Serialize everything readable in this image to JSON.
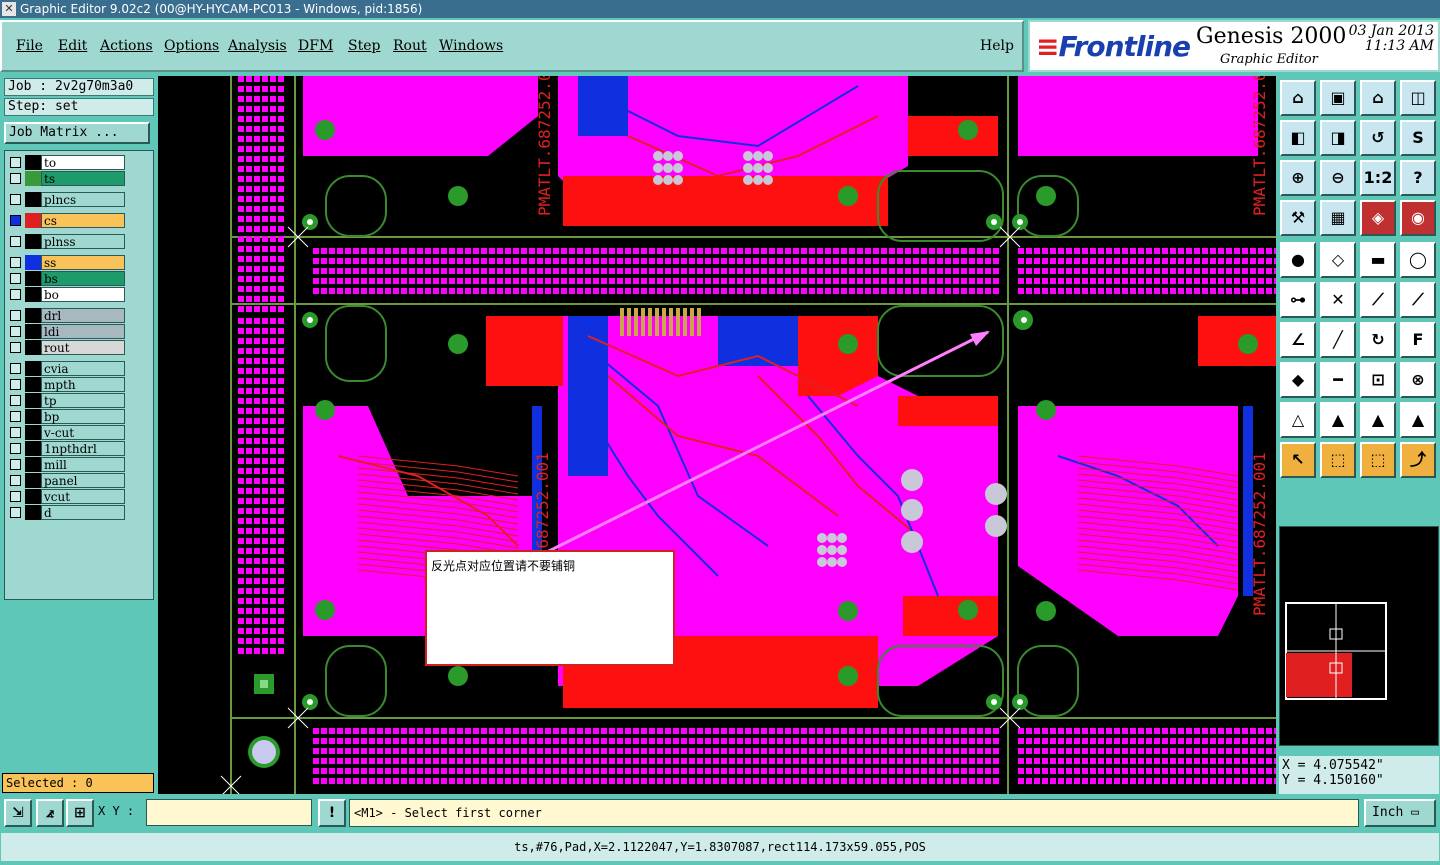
{
  "window": {
    "title": "Graphic Editor 9.02c2 (00@HY-HYCAM-PC013 - Windows, pid:1856)"
  },
  "menu": [
    "File",
    "Edit",
    "Actions",
    "Options",
    "Analysis",
    "DFM",
    "Step",
    "Rout",
    "Windows"
  ],
  "help": "Help",
  "brand": {
    "logo": "Frontline",
    "product": "Genesis 2000",
    "subtitle": "Graphic Editor",
    "date": "03 Jan 2013",
    "time": "11:13 AM"
  },
  "job": {
    "job_line": "Job : 2v2g70m3a0",
    "step_line": "Step: set",
    "matrix_button": "Job Matrix ..."
  },
  "layers": [
    {
      "name": "to",
      "color": "#ffffff",
      "swatch": "#000000"
    },
    {
      "name": "ts",
      "color": "#1f9a6a",
      "swatch": "#3a9a3a"
    },
    {
      "name": "plncs",
      "color": "#9fd8d0",
      "swatch": "#000000"
    },
    {
      "name": "cs",
      "color": "#f9c35a",
      "swatch": "#e02020",
      "active": true
    },
    {
      "name": "plnss",
      "color": "#9fd8d0",
      "swatch": "#000000"
    },
    {
      "name": "ss",
      "color": "#f9c35a",
      "swatch": "#1030e0"
    },
    {
      "name": "bs",
      "color": "#1f9a6a",
      "swatch": "#000000"
    },
    {
      "name": "bo",
      "color": "#ffffff",
      "swatch": "#000000"
    },
    {
      "name": "drl",
      "color": "#a8b8c0",
      "swatch": "#000000"
    },
    {
      "name": "ldi",
      "color": "#a8b8c0",
      "swatch": "#000000"
    },
    {
      "name": "rout",
      "color": "#d8d8d8",
      "swatch": "#000000"
    },
    {
      "name": "cvia",
      "color": "#9fd8d0",
      "swatch": "#000000"
    },
    {
      "name": "mpth",
      "color": "#9fd8d0",
      "swatch": "#000000"
    },
    {
      "name": "tp",
      "color": "#9fd8d0",
      "swatch": "#000000"
    },
    {
      "name": "bp",
      "color": "#9fd8d0",
      "swatch": "#000000"
    },
    {
      "name": "v-cut",
      "color": "#9fd8d0",
      "swatch": "#000000"
    },
    {
      "name": "1npthdrl",
      "color": "#9fd8d0",
      "swatch": "#000000"
    },
    {
      "name": "mill",
      "color": "#9fd8d0",
      "swatch": "#000000"
    },
    {
      "name": "panel",
      "color": "#9fd8d0",
      "swatch": "#000000"
    },
    {
      "name": "vcut",
      "color": "#9fd8d0",
      "swatch": "#000000"
    },
    {
      "name": "d",
      "color": "#9fd8d0",
      "swatch": "#000000"
    }
  ],
  "selected": "Selected : 0",
  "pcb": {
    "silk_text": "PMATLT.687252.001",
    "note": "反光点对应位置请不要铺铜"
  },
  "minimap": {
    "label": "view-window"
  },
  "coords": {
    "x": "X = 4.075542\"",
    "y": "Y = 4.150160\""
  },
  "bottom": {
    "xy_label": "X Y :",
    "xy_value": "",
    "message": "<M1> - Select first corner",
    "unit": "Inch"
  },
  "status": "ts,#76,Pad,X=2.1122047,Y=1.8307087,rect114.173x59.055,POS",
  "icons": [
    "home-icon",
    "open-icon",
    "zoom-in-icon",
    "zoom-out-icon",
    "ruler-icon",
    "select-icon"
  ],
  "colors": {
    "copper": "#ff00ff",
    "red_copper": "#ff1010",
    "trace": "#e02020",
    "blue_trace": "#1030e0",
    "pad_green": "#2a9a2a"
  }
}
